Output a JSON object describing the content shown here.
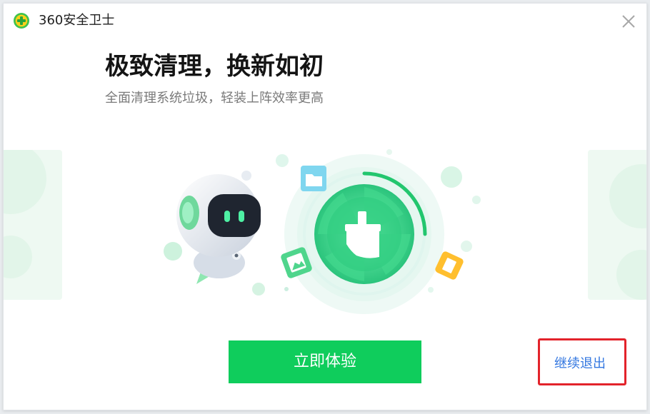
{
  "window": {
    "title": "360安全卫士",
    "logo_icon": "360-shield-plus-icon",
    "close_icon": "close-icon"
  },
  "content": {
    "headline": "极致清理，换新如初",
    "subline": "全面清理系统垃圾，轻装上阵效率更高"
  },
  "illustration": {
    "robot_icon": "robot-mascot-icon",
    "cleaner_icon": "broom-cleaner-icon",
    "floating_icons": [
      "folder-icon",
      "image-icon",
      "document-icon"
    ],
    "progress_ring": 0.25
  },
  "actions": {
    "primary_label": "立即体验",
    "exit_label": "继续退出"
  },
  "colors": {
    "brand_green": "#0fcd5c",
    "link_blue": "#3377e0",
    "highlight_red": "#e3232b"
  }
}
